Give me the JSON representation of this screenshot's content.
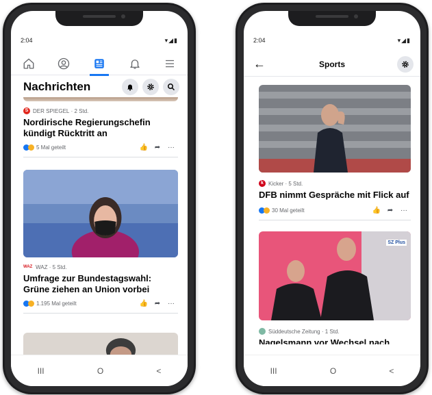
{
  "left_phone": {
    "status_time": "2:04",
    "nav_tabs": [
      {
        "icon": "home-icon",
        "active": false
      },
      {
        "icon": "profile-icon",
        "active": false
      },
      {
        "icon": "news-icon",
        "active": true
      },
      {
        "icon": "bell-icon",
        "active": false
      },
      {
        "icon": "menu-icon",
        "active": false
      }
    ],
    "header_title": "Nachrichten",
    "articles": [
      {
        "source": "DER SPIEGEL",
        "time": "2 Std.",
        "headline": "Nordirische Regierungschefin kündigt Rücktritt an",
        "shares": "5 Mal geteilt",
        "source_color": "#e1261c"
      },
      {
        "source": "WAZ",
        "time": "5 Std.",
        "headline": "Umfrage zur Bundestagswahl: Grüne ziehen an Union vorbei",
        "shares": "1.195 Mal geteilt",
        "source_color": "#d71920"
      }
    ]
  },
  "right_phone": {
    "status_time": "2:04",
    "header_title": "Sports",
    "articles": [
      {
        "source": "Kicker",
        "time": "5 Std.",
        "headline": "DFB nimmt Gespräche mit Flick auf",
        "shares": "30 Mal geteilt",
        "source_color": "#d0021b"
      },
      {
        "source": "Süddeutsche Zeitung",
        "time": "1 Std.",
        "headline": "Nagelsmann vor Wechsel nach",
        "source_color": "#7fb9a4",
        "image_badge": "SZ Plus"
      }
    ]
  },
  "android_nav": {
    "recent": "III",
    "home": "O",
    "back": "<"
  },
  "colors": {
    "accent": "#1877f2",
    "like": "#1877f2",
    "wow": "#f7b125"
  }
}
